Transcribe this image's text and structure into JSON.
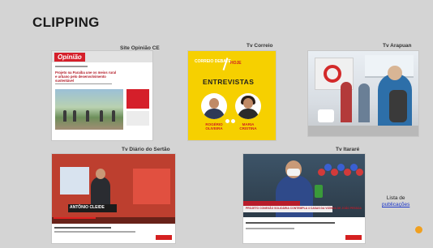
{
  "slide": {
    "title": "CLIPPING",
    "background": "#d4d4d4",
    "accent": "#f0a020"
  },
  "items": [
    {
      "caption": "Site Opinião CE",
      "content": {
        "logo": "Opinião",
        "headline": "Projeto na Paraíba une os meios rural e urbano pelo desenvolvimento sustentável"
      }
    },
    {
      "caption": "Tv Correio",
      "content": {
        "tag": "CORREIO DEBATE",
        "day": "HOJE",
        "heading": "ENTREVISTAS",
        "guest_1": "ROGÉRIO OLIVEIRA",
        "guest_2": "MARIA CRISTINA"
      }
    },
    {
      "caption": "Tv Arapuan"
    },
    {
      "caption": "Tv Diário do Sertão",
      "content": {
        "lower_third": "ANTÔNIO CLEIDE"
      }
    },
    {
      "caption": "Tv Itararé",
      "content": {
        "lower_third": "PROJETO CONEXÃO SOLIDÁRIA CONTEMPLA 4 CASAS DA VIZINHA DE JOÃO PESSOA"
      }
    }
  ],
  "list_link": {
    "label": "Lista de",
    "link_text": "publicações"
  },
  "icons": {
    "corner": "orange-dot-icon"
  }
}
